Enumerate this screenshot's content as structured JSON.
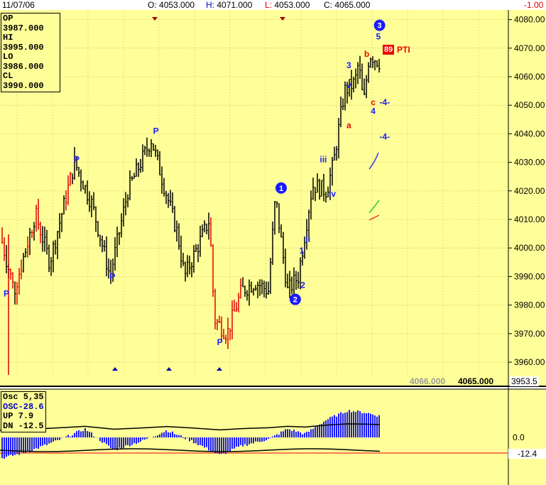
{
  "header": {
    "date": "11/07/06",
    "open_label": "O:",
    "open": "4053.000",
    "high_label": "H:",
    "high": "4071.000",
    "low_label": "L:",
    "low": "4053.000",
    "close_label": "C:",
    "close": "4065.000",
    "change": "-1.00"
  },
  "info_box": {
    "lines": [
      "OP 3987.000",
      "HI  3995.000",
      "LO  3986.000",
      "CL  3990.000"
    ]
  },
  "price_axis": {
    "ticks": [
      "4080.00",
      "4070.00",
      "4060.00",
      "4050.00",
      "4040.00",
      "4030.00",
      "4020.00",
      "4010.00",
      "4000.00",
      "3990.00",
      "3980.00",
      "3970.00",
      "3960.00"
    ],
    "bottom_value": "3953.5"
  },
  "bottom_values": {
    "left": "4066.000",
    "right": "4065.000"
  },
  "osc_box": {
    "title": "Osc 5,35",
    "osc": "OSC-28.6",
    "up": "UP   7.9",
    "dn": "DN   -12.5"
  },
  "osc_axis": {
    "zero": "0.0",
    "level": "-12.4"
  },
  "pti": {
    "value": "89",
    "label": "PTI"
  },
  "colors": {
    "background": "#ffff99",
    "up_bar": "#000000",
    "down_bar": "#e00000",
    "wave_label": "#1a1aff",
    "osc_hist": "#1a1aff"
  },
  "chart_data": [
    {
      "type": "bar",
      "description_kind": "OHLC price bars with Elliott wave labels",
      "ylim": [
        3953.5,
        4082
      ],
      "title": "",
      "annotations": [
        {
          "text": "P",
          "x": 5,
          "y": 3983
        },
        {
          "text": "P",
          "x": 60,
          "y": 4030
        },
        {
          "text": "P",
          "x": 88,
          "y": 3989
        },
        {
          "text": "P",
          "x": 122,
          "y": 4040
        },
        {
          "text": "P",
          "x": 172,
          "y": 3966
        },
        {
          "text": "iii",
          "x": 253,
          "y": 4030
        },
        {
          "text": "iv",
          "x": 260,
          "y": 4018
        },
        {
          "text": "ii",
          "x": 241,
          "y": 4002
        },
        {
          "text": "1",
          "x": 236,
          "y": 3998
        },
        {
          "text": "2",
          "x": 237,
          "y": 3986
        },
        {
          "text": "a",
          "x": 273,
          "y": 4042
        },
        {
          "text": "v",
          "x": 273,
          "y": 4056
        },
        {
          "text": "3",
          "x": 273,
          "y": 4063
        },
        {
          "text": "b",
          "x": 287,
          "y": 4067
        },
        {
          "text": "c",
          "x": 292,
          "y": 4050
        },
        {
          "text": "4",
          "x": 292,
          "y": 4047
        },
        {
          "text": "5",
          "x": 296,
          "y": 4073
        },
        {
          "text": "-4-",
          "x": 301,
          "y": 4050
        },
        {
          "text": "-4-",
          "x": 301,
          "y": 4038
        }
      ],
      "circled_labels": [
        {
          "text": "1",
          "x": 220,
          "y": 4021
        },
        {
          "text": "2",
          "x": 231,
          "y": 3982
        },
        {
          "text": "3",
          "x": 297,
          "y": 4078
        }
      ]
    },
    {
      "type": "area",
      "title": "Osc 5,35",
      "series": [
        {
          "name": "OSC",
          "value": -28.6
        },
        {
          "name": "UP",
          "value": 7.9
        },
        {
          "name": "DN",
          "value": -12.5
        }
      ]
    }
  ]
}
